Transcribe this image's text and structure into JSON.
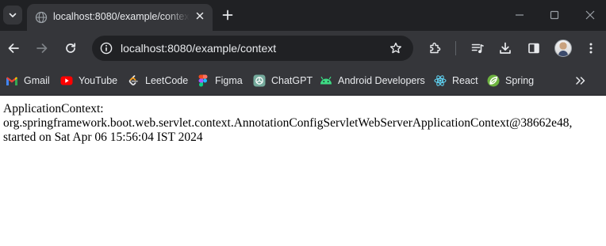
{
  "tabs": [
    {
      "title": "localhost:8080/example/context",
      "active": true
    }
  ],
  "toolbar": {
    "url": "localhost:8080/example/context"
  },
  "bookmarks": [
    {
      "label": "Gmail",
      "icon": "gmail-icon"
    },
    {
      "label": "YouTube",
      "icon": "youtube-icon"
    },
    {
      "label": "LeetCode",
      "icon": "leetcode-icon"
    },
    {
      "label": "Figma",
      "icon": "figma-icon"
    },
    {
      "label": "ChatGPT",
      "icon": "chatgpt-icon"
    },
    {
      "label": "Android Developers",
      "icon": "android-icon"
    },
    {
      "label": "React",
      "icon": "react-icon"
    },
    {
      "label": "Spring",
      "icon": "spring-icon"
    }
  ],
  "page": {
    "lines": [
      "ApplicationContext:",
      "org.springframework.boot.web.servlet.context.AnnotationConfigServletWebServerApplicationContext@38662e48,",
      "started on Sat Apr 06 15:56:04 IST 2024"
    ]
  },
  "colors": {
    "chrome_dark": "#202124",
    "chrome_toolbar": "#35363a",
    "text_light": "#e8eaed",
    "page_background": "#ffffff"
  }
}
